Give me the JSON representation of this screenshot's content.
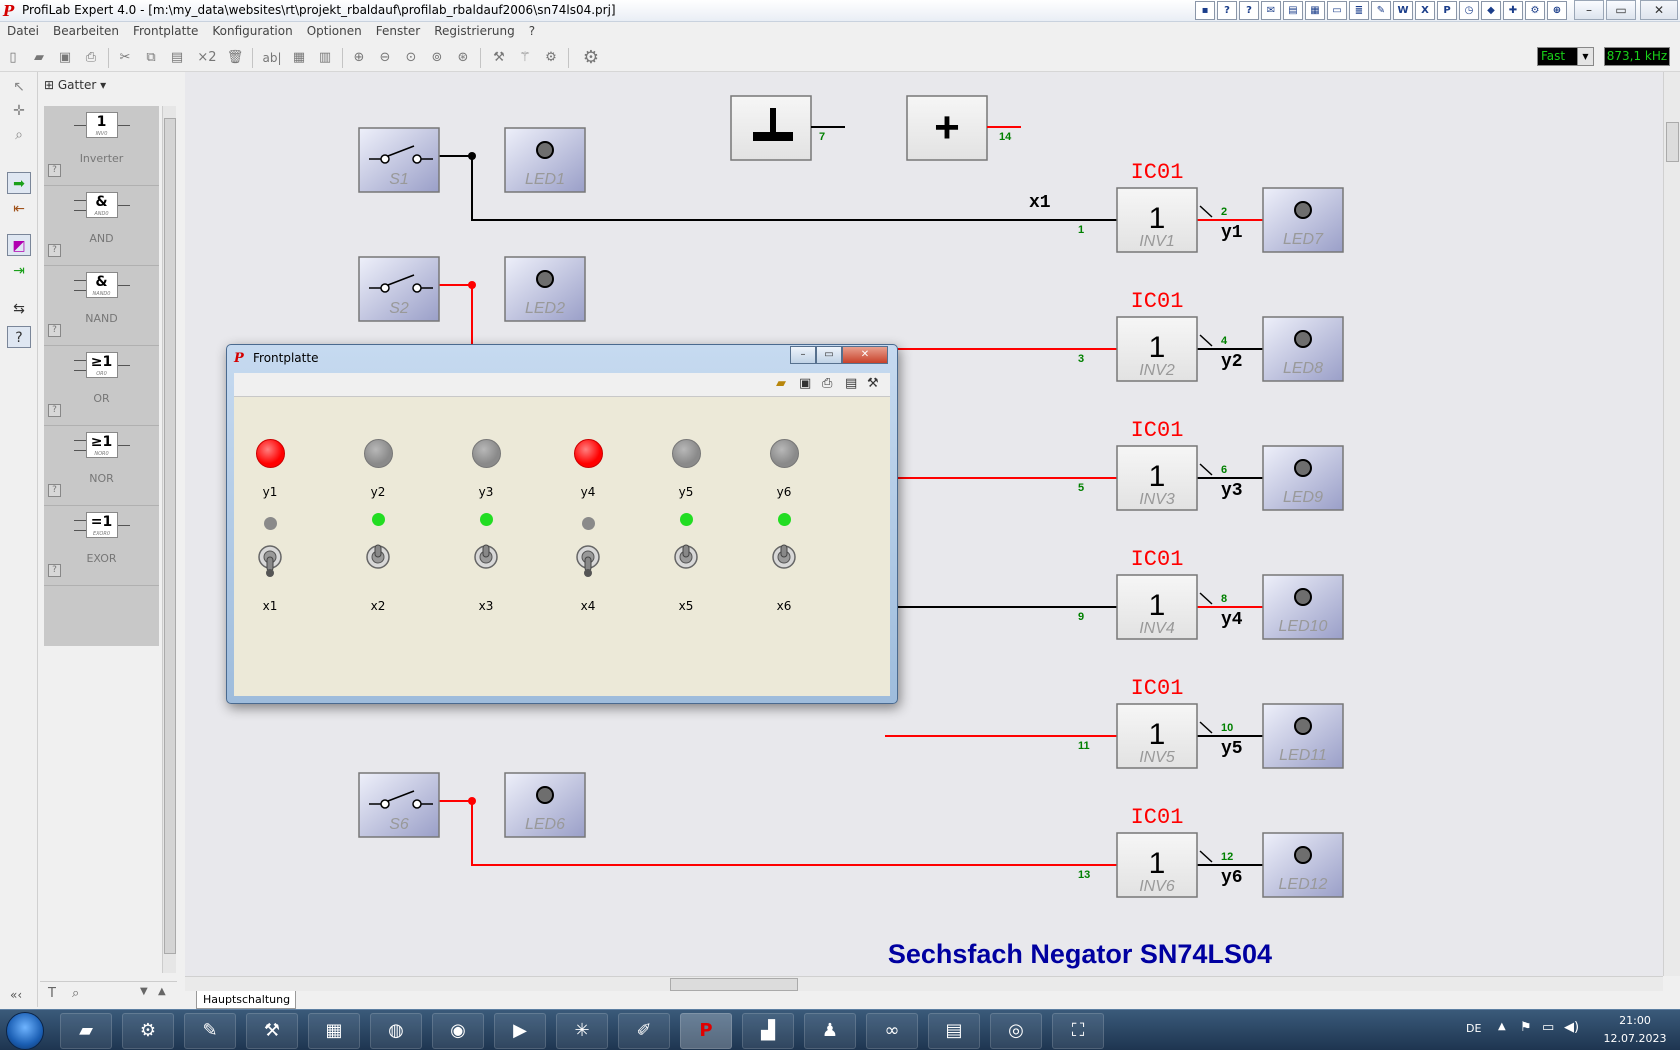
{
  "window": {
    "title": "ProfiLab Expert 4.0 - [m:\\my_data\\websites\\rt\\projekt_rbaldauf\\profilab_rbaldauf2006\\sn74ls04.prj]"
  },
  "menu": [
    "Datei",
    "Bearbeiten",
    "Frontplatte",
    "Konfiguration",
    "Optionen",
    "Fenster",
    "Registrierung",
    "?"
  ],
  "toolbar": {
    "speed": "Fast",
    "frequency": "873,1 kHz",
    "multiply_label": "×2",
    "text_tool": "ab|"
  },
  "library": {
    "group": "Gatter",
    "items": [
      {
        "symbol": "1",
        "tag": "INV0",
        "label": "Inverter"
      },
      {
        "symbol": "&",
        "tag": "AND0",
        "label": "AND"
      },
      {
        "symbol": "&",
        "tag": "NAND0",
        "label": "NAND"
      },
      {
        "symbol": "≥1",
        "tag": "OR0",
        "label": "OR"
      },
      {
        "symbol": "≥1",
        "tag": "NOR0",
        "label": "NOR"
      },
      {
        "symbol": "=1",
        "tag": "EXOR0",
        "label": "EXOR"
      }
    ],
    "help": "?"
  },
  "circuit": {
    "gnd_pin": "7",
    "vcc_pin": "14",
    "switches": [
      "S1",
      "S2",
      "S6"
    ],
    "input_leds": [
      "LED1",
      "LED2",
      "LED6"
    ],
    "x1_label": "x1",
    "ic_label": "IC01",
    "gates": [
      {
        "name": "INV1",
        "in": "1",
        "out": "2",
        "y": "y1",
        "led": "LED7",
        "in_active": false,
        "out_active": true
      },
      {
        "name": "INV2",
        "in": "3",
        "out": "4",
        "y": "y2",
        "led": "LED8",
        "in_active": true,
        "out_active": false
      },
      {
        "name": "INV3",
        "in": "5",
        "out": "6",
        "y": "y3",
        "led": "LED9",
        "in_active": true,
        "out_active": false
      },
      {
        "name": "INV4",
        "in": "9",
        "out": "8",
        "y": "y4",
        "led": "LED10",
        "in_active": false,
        "out_active": true
      },
      {
        "name": "INV5",
        "in": "11",
        "out": "10",
        "y": "y5",
        "led": "LED11",
        "in_active": true,
        "out_active": false
      },
      {
        "name": "INV6",
        "in": "13",
        "out": "12",
        "y": "y6",
        "led": "LED12",
        "in_active": true,
        "out_active": false
      }
    ],
    "gate_symbol": "1",
    "caption": "Sechsfach Negator SN74LS04"
  },
  "sheet_tab": "Hauptschaltung",
  "frontplate": {
    "title": "Frontplatte",
    "outputs": [
      {
        "label": "y1",
        "on": true
      },
      {
        "label": "y2",
        "on": false
      },
      {
        "label": "y3",
        "on": false
      },
      {
        "label": "y4",
        "on": true
      },
      {
        "label": "y5",
        "on": false
      },
      {
        "label": "y6",
        "on": false
      }
    ],
    "inputs": [
      {
        "label": "x1",
        "on": false
      },
      {
        "label": "x2",
        "on": true
      },
      {
        "label": "x3",
        "on": true
      },
      {
        "label": "x4",
        "on": false
      },
      {
        "label": "x5",
        "on": true
      },
      {
        "label": "x6",
        "on": true
      }
    ]
  },
  "taskbar": {
    "lang": "DE",
    "time": "21:00",
    "date": "12.07.2023"
  },
  "colors": {
    "active_wire": "#ff0000",
    "idle_wire": "#000000",
    "ic_label": "#ff0000",
    "pin_label": "#008000",
    "caption": "#0000a0",
    "led_on": "#ff0000",
    "small_led_on": "#22dd22",
    "led_off": "#8a8a8a"
  }
}
